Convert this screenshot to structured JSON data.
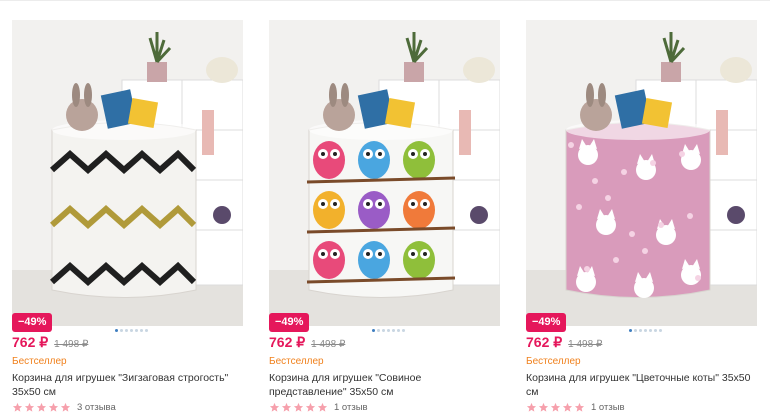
{
  "products": [
    {
      "discount": "−49%",
      "price": "762 ₽",
      "old_price": "1 498 ₽",
      "badge": "Бестселлер",
      "title": "Корзина для игрушек \"Зигзаговая строгость\" 35х50 см",
      "reviews": "3 отзыва",
      "rating": 5,
      "image_dots": 7,
      "active_dot": 0,
      "pattern": "zigzag",
      "colors": {
        "basket": "#f4f3f0",
        "accent1": "#1f1f1f",
        "accent2": "#b09a3a"
      }
    },
    {
      "discount": "−49%",
      "price": "762 ₽",
      "old_price": "1 498 ₽",
      "badge": "Бестселлер",
      "title": "Корзина для игрушек \"Совиное представление\" 35х50 см",
      "reviews": "1 отзыв",
      "rating": 5,
      "image_dots": 7,
      "active_dot": 0,
      "pattern": "owls",
      "colors": {
        "basket": "#f7f7f5",
        "accent1": "#e84a7a",
        "accent2": "#8fbf3a"
      }
    },
    {
      "discount": "−49%",
      "price": "762 ₽",
      "old_price": "1 498 ₽",
      "badge": "Бестселлер",
      "title": "Корзина для игрушек \"Цветочные коты\" 35х50 см",
      "reviews": "1 отзыв",
      "rating": 5,
      "image_dots": 7,
      "active_dot": 0,
      "pattern": "cats",
      "colors": {
        "basket": "#d99bbb",
        "accent1": "#ffffff",
        "accent2": "#c07aa0"
      }
    }
  ],
  "theme": {
    "accent": "#e5175b",
    "badge": "#f0811d",
    "star": "#f6a0ac"
  }
}
